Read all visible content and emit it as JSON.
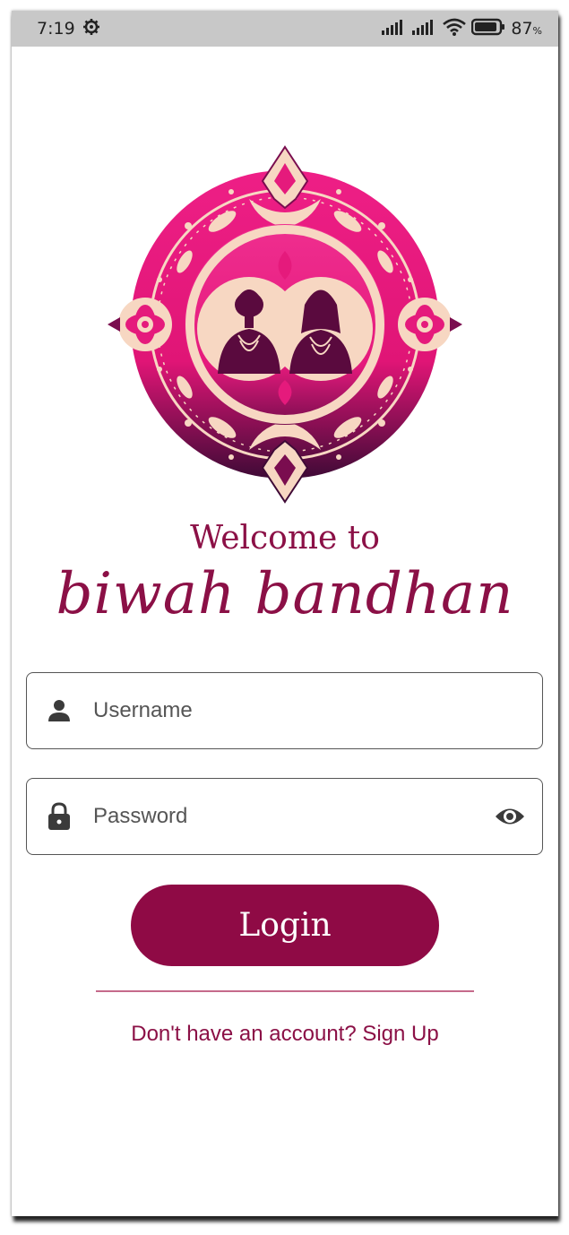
{
  "status_bar": {
    "time": "7:19",
    "battery": "87",
    "battery_unit": "%"
  },
  "brand": {
    "welcome": "Welcome to",
    "app_name": "biwah bandhan"
  },
  "form": {
    "username_placeholder": "Username",
    "password_placeholder": "Password",
    "login_label": "Login",
    "signup_text": "Don't have an account? Sign Up"
  },
  "colors": {
    "primary": "#8f0a45",
    "text_primary": "#8b1046",
    "divider": "#c56a8b",
    "logo_pink": "#e6157f",
    "logo_purple": "#4a0a3a",
    "logo_cream": "#f7d7c2"
  },
  "icons": [
    "settings-icon",
    "signal-icon",
    "wifi-icon",
    "battery-icon",
    "person-icon",
    "lock-icon",
    "eye-icon"
  ]
}
